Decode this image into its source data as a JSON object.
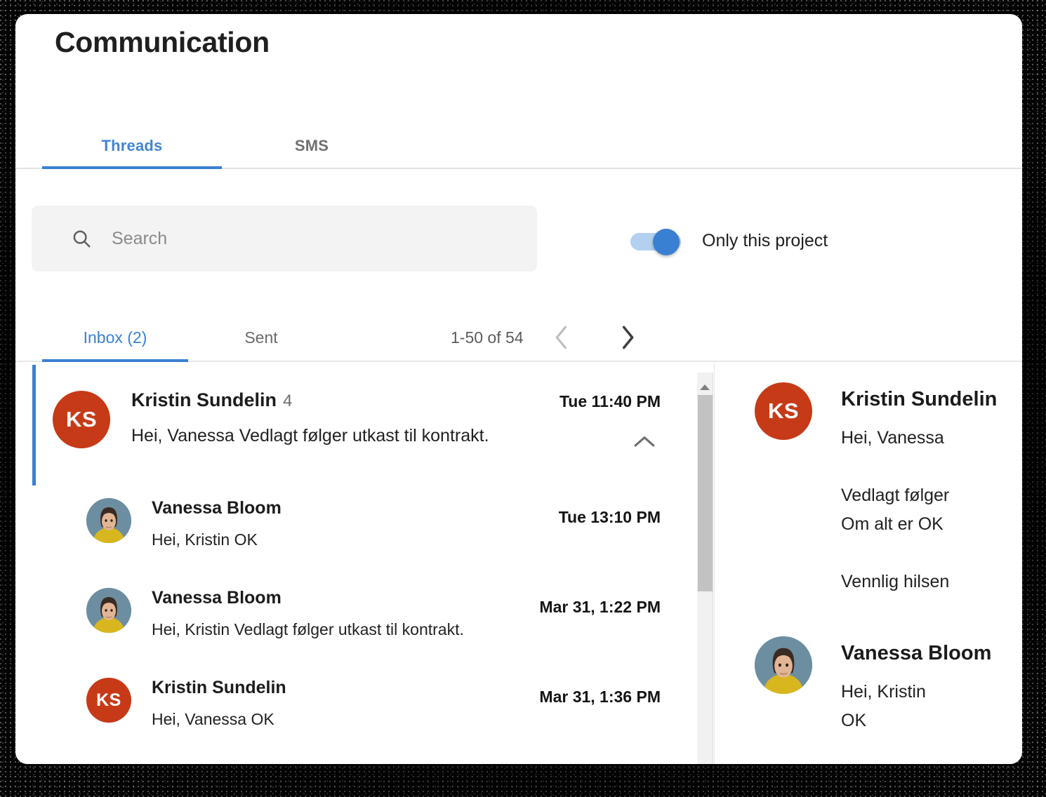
{
  "page_title": "Communication",
  "top_tabs": [
    {
      "id": "threads",
      "label": "Threads",
      "active": true
    },
    {
      "id": "sms",
      "label": "SMS",
      "active": false
    }
  ],
  "search": {
    "placeholder": "Search",
    "value": "",
    "icon": "search-icon"
  },
  "project_toggle": {
    "label": "Only this project",
    "state": "on",
    "accent_color": "#3a80d2",
    "track_color": "#b4d0f0"
  },
  "sub_tabs": [
    {
      "id": "inbox",
      "label": "Inbox (2)",
      "active": true
    },
    {
      "id": "sent",
      "label": "Sent",
      "active": false
    }
  ],
  "pagination": {
    "range": "1-50 of 54",
    "prev_icon": "chevron-left-icon",
    "next_icon": "chevron-right-icon",
    "prev_enabled": false,
    "next_enabled": true
  },
  "thread": {
    "selected": true,
    "accent_color": "#3a80d2",
    "head": {
      "sender": "Kristin Sundelin",
      "count": "4",
      "preview": "Hei, Vanessa Vedlagt følger utkast til kontrakt.",
      "time": "Tue 11:40 PM",
      "avatar": {
        "type": "initials",
        "initials": "KS",
        "color": "#c63a18"
      },
      "collapse_icon": "chevron-up-icon",
      "expanded": true
    },
    "messages": [
      {
        "sender": "Vanessa Bloom",
        "preview": "Hei, Kristin OK",
        "time": "Tue 13:10 PM",
        "avatar": {
          "type": "photo",
          "alt": "Vanessa Bloom photo",
          "bg": "#6d8ea1"
        }
      },
      {
        "sender": "Vanessa Bloom",
        "preview": "Hei, Kristin Vedlagt følger utkast til kontrakt.",
        "time": "Mar 31, 1:22 PM",
        "avatar": {
          "type": "photo",
          "alt": "Vanessa Bloom photo",
          "bg": "#6d8ea1"
        }
      },
      {
        "sender": "Kristin Sundelin",
        "preview": "Hei, Vanessa OK",
        "time": "Mar 31, 1:36 PM",
        "avatar": {
          "type": "initials",
          "initials": "KS",
          "color": "#c63a18"
        }
      }
    ]
  },
  "scrollbar": {
    "up_arrow_icon": "triangle-up-icon",
    "thumb_color": "#c2c2c2",
    "track_color": "#f1f1f1"
  },
  "detail": {
    "messages": [
      {
        "sender": "Kristin Sundelin",
        "body": "Hei, Vanessa\n\nVedlagt følger\nOm alt er OK\n\nVennlig hilsen",
        "avatar": {
          "type": "initials",
          "initials": "KS",
          "color": "#c63a18"
        }
      },
      {
        "sender": "Vanessa Bloom",
        "body": "Hei, Kristin\nOK",
        "avatar": {
          "type": "photo",
          "alt": "Vanessa Bloom photo",
          "bg": "#6d8ea1"
        }
      }
    ]
  }
}
